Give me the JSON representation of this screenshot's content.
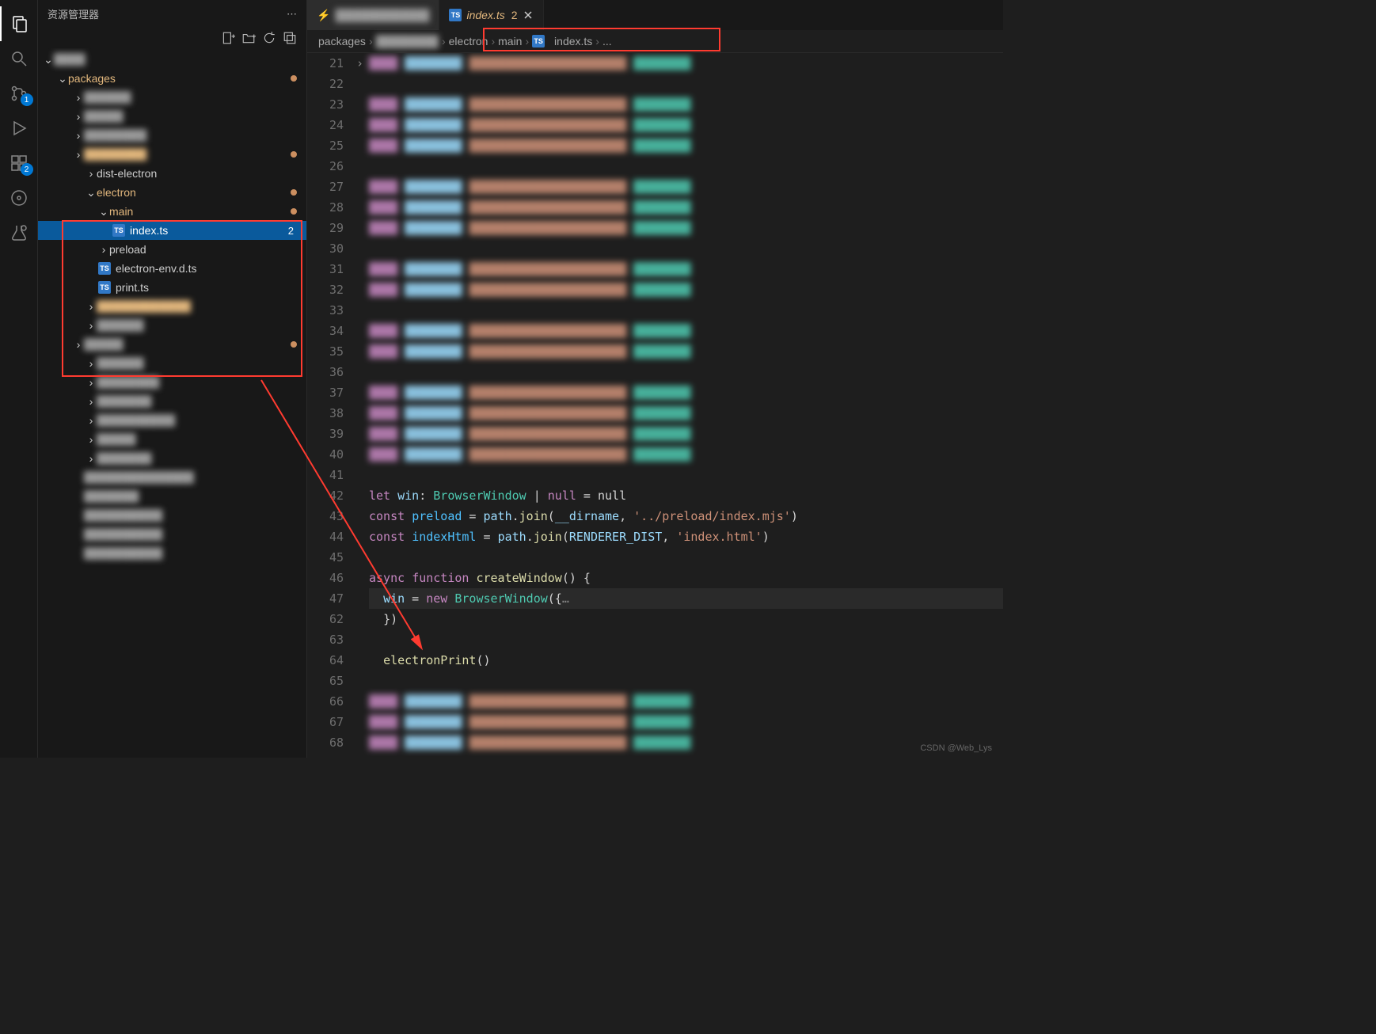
{
  "activity": {
    "items": [
      {
        "name": "explorer-icon",
        "badge": null,
        "active": true
      },
      {
        "name": "search-icon",
        "badge": null
      },
      {
        "name": "source-control-icon",
        "badge": "1"
      },
      {
        "name": "run-icon",
        "badge": null
      },
      {
        "name": "extensions-icon",
        "badge": "2"
      },
      {
        "name": "git-branch-icon",
        "badge": null
      },
      {
        "name": "test-icon",
        "badge": null
      }
    ]
  },
  "sidebar": {
    "title": "资源管理器",
    "root": "blur",
    "packages_label": "packages",
    "items": [
      {
        "indent": 3,
        "twisty": "",
        "label": "blur",
        "kind": "blur"
      },
      {
        "indent": 3,
        "twisty": "",
        "label": "blur",
        "kind": "blur"
      },
      {
        "indent": 3,
        "twisty": "",
        "label": "blur",
        "kind": "blur"
      },
      {
        "indent": 3,
        "twisty": "",
        "label": "blur",
        "kind": "blur-orange",
        "dot": true
      }
    ],
    "dist_electron": "dist-electron",
    "electron": "electron",
    "main": "main",
    "index_ts": "index.ts",
    "index_badge": "2",
    "preload": "preload",
    "env_dts": "electron-env.d.ts",
    "print_ts": "print.ts",
    "below": [
      {
        "label": "blur",
        "indent": 3,
        "kind": "blur-orange"
      },
      {
        "label": "blur",
        "indent": 3,
        "kind": "blur"
      },
      {
        "label": "blur",
        "indent": 2,
        "kind": "blur",
        "dot": true
      },
      {
        "label": "blur",
        "indent": 3,
        "kind": "blur"
      },
      {
        "label": "blur",
        "indent": 3,
        "kind": "blur"
      },
      {
        "label": "blur",
        "indent": 3,
        "kind": "blur"
      },
      {
        "label": "blur",
        "indent": 3,
        "kind": "blur"
      },
      {
        "label": "blur",
        "indent": 3,
        "kind": "blur"
      },
      {
        "label": "blur",
        "indent": 3,
        "kind": "blur"
      },
      {
        "label": "blur",
        "indent": 2,
        "kind": "blur"
      },
      {
        "label": "blur",
        "indent": 2,
        "kind": "blur"
      },
      {
        "label": "blur",
        "indent": 2,
        "kind": "blur"
      },
      {
        "label": "blur",
        "indent": 2,
        "kind": "blur"
      },
      {
        "label": "blur",
        "indent": 2,
        "kind": "blur"
      }
    ]
  },
  "tabs": [
    {
      "label": "blur",
      "active": false,
      "icon": "vite"
    },
    {
      "label": "index.ts",
      "active": true,
      "icon": "ts",
      "badge": "2"
    }
  ],
  "breadcrumb": {
    "items": [
      {
        "label": "packages"
      },
      {
        "label": "blur",
        "blur": true
      },
      {
        "label": "electron",
        "hl": true
      },
      {
        "label": "main",
        "hl": true
      },
      {
        "label": "index.ts",
        "icon": "ts",
        "hl": true
      },
      {
        "label": "...",
        "hl": true
      }
    ]
  },
  "code": {
    "lines": [
      {
        "n": 21,
        "blur": true
      },
      {
        "n": 22,
        "content": ""
      },
      {
        "n": 23,
        "blur": true
      },
      {
        "n": 24,
        "blur": true
      },
      {
        "n": 25,
        "blur": true
      },
      {
        "n": 26,
        "content": ""
      },
      {
        "n": 27,
        "blur": true
      },
      {
        "n": 28,
        "blur": true
      },
      {
        "n": 29,
        "blur": true
      },
      {
        "n": 30,
        "content": ""
      },
      {
        "n": 31,
        "blur": true
      },
      {
        "n": 32,
        "blur": true
      },
      {
        "n": 33,
        "content": ""
      },
      {
        "n": 34,
        "blur": true
      },
      {
        "n": 35,
        "blur": true
      },
      {
        "n": 36,
        "content": ""
      },
      {
        "n": 37,
        "blur": true
      },
      {
        "n": 38,
        "blur": true
      },
      {
        "n": 39,
        "blur": true
      },
      {
        "n": 40,
        "blur": true
      },
      {
        "n": 41,
        "content": ""
      },
      {
        "n": 42,
        "type": "let-win"
      },
      {
        "n": 43,
        "type": "preload"
      },
      {
        "n": 44,
        "type": "indexHtml"
      },
      {
        "n": 45,
        "content": ""
      },
      {
        "n": 46,
        "type": "async-fn"
      },
      {
        "n": 47,
        "type": "win-new",
        "hl": true,
        "fold": true
      },
      {
        "n": 62,
        "type": "close-brace"
      },
      {
        "n": 63,
        "content": ""
      },
      {
        "n": 64,
        "type": "electron-print"
      },
      {
        "n": 65,
        "content": ""
      },
      {
        "n": 66,
        "blur": true
      },
      {
        "n": 67,
        "blur": true
      },
      {
        "n": 68,
        "blur": true
      }
    ],
    "text": {
      "let": "let",
      "win": "win",
      "colon": ":",
      "BrowserWindow": "BrowserWindow",
      "pipe_null": " | ",
      "null": "null",
      "eq_null": " = null",
      "const": "const",
      "preload": "preload",
      "eq": " = ",
      "path": "path",
      "dot": ".",
      "join": "join",
      "dirname": "__dirname",
      "preload_str": "'../preload/index.mjs'",
      "indexHtml": "indexHtml",
      "RENDERER_DIST": "RENDERER_DIST",
      "index_html_str": "'index.html'",
      "async": "async",
      "function": "function",
      "createWindow": "createWindow",
      "open_brace": "() {",
      "win_eq": " = ",
      "new": "new",
      "open_obj": "({",
      "ellipsis": "…",
      "close_obj": "})",
      "electronPrint": "electronPrint",
      "call": "()"
    }
  },
  "watermark": "CSDN @Web_Lys"
}
